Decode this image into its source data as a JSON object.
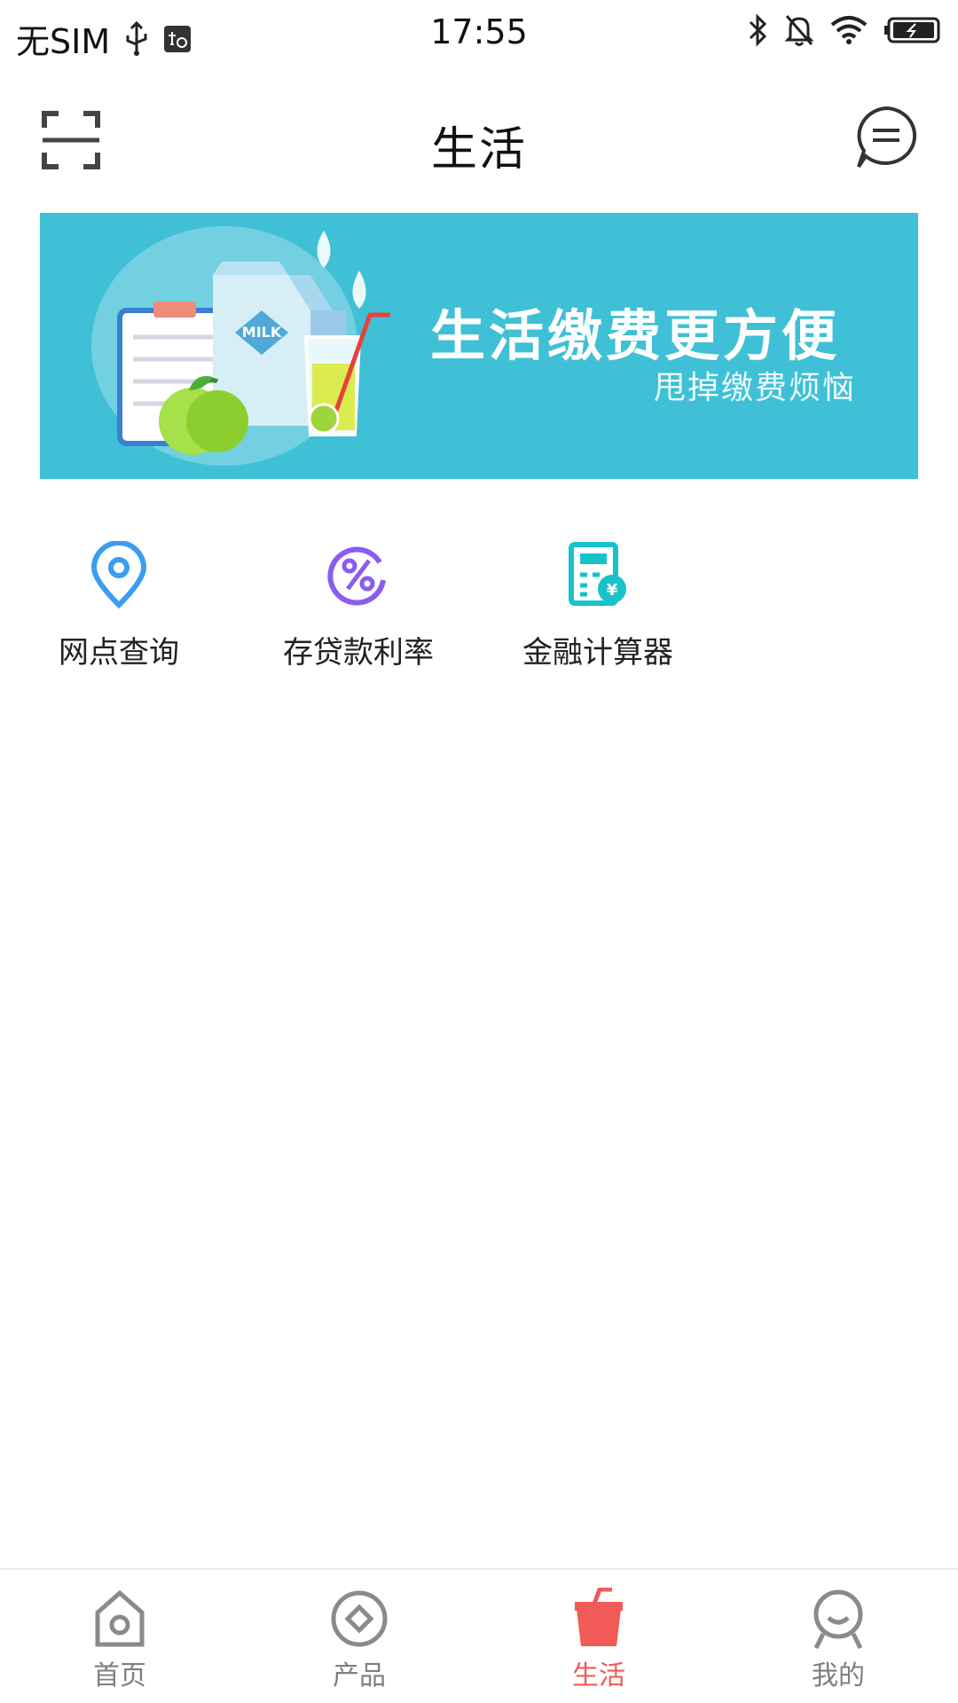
{
  "status_bar": {
    "carrier": "无SIM",
    "time": "17:55",
    "icons": [
      "usb-icon",
      "debug-icon",
      "bluetooth-icon",
      "bell-muted-icon",
      "wifi-icon",
      "battery-icon"
    ]
  },
  "header": {
    "title": "生活",
    "left_icon": "scan-icon",
    "right_icon": "message-icon"
  },
  "banner": {
    "title": "生活缴费更方便",
    "subtitle": "甩掉缴费烦恼",
    "illustration_text": "MILK",
    "background_color": "#3fc0d6"
  },
  "services": [
    {
      "label": "网点查询",
      "icon": "location-pin-icon",
      "color": "#3a9df2"
    },
    {
      "label": "存贷款利率",
      "icon": "percent-icon",
      "color": "#8a5cf0"
    },
    {
      "label": "金融计算器",
      "icon": "calculator-icon",
      "color": "#17c3c8"
    }
  ],
  "tabbar": {
    "active_color": "#f05a57",
    "inactive_color": "#8a8a8a",
    "tabs": [
      {
        "label": "首页",
        "icon": "home-icon",
        "active": false
      },
      {
        "label": "产品",
        "icon": "product-icon",
        "active": false
      },
      {
        "label": "生活",
        "icon": "cup-icon",
        "active": true
      },
      {
        "label": "我的",
        "icon": "user-icon",
        "active": false
      }
    ]
  }
}
